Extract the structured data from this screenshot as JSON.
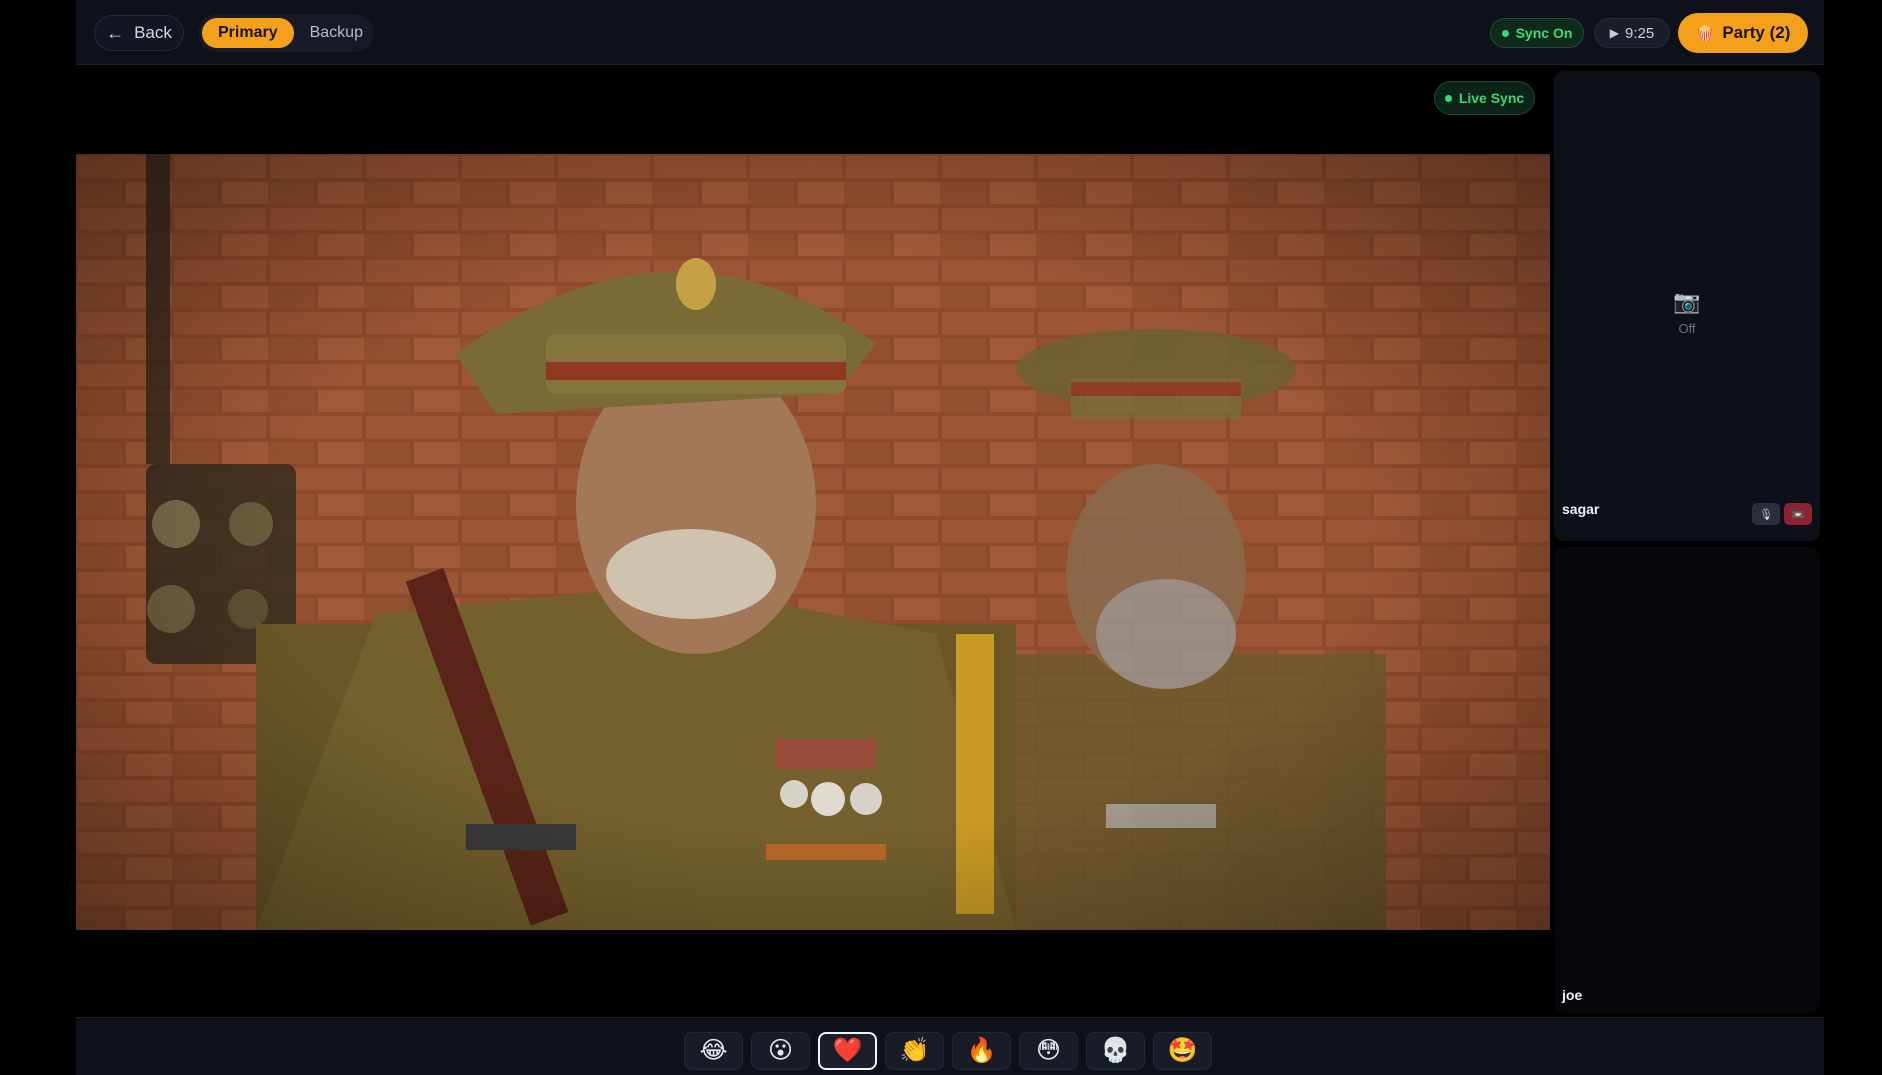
{
  "header": {
    "back_label": "Back",
    "sources": [
      {
        "label": "Primary",
        "active": true
      },
      {
        "label": "Backup",
        "active": false
      }
    ],
    "sync_label": "Sync On",
    "time_label": "9:25",
    "party_label": "Party (2)"
  },
  "player": {
    "live_label": "Live Sync"
  },
  "participants": [
    {
      "name": "sagar",
      "camera_status": "Off",
      "mic_icon": "mic-icon",
      "camera_icon": "camera-off-icon"
    },
    {
      "name": "joe"
    }
  ],
  "reactions": [
    {
      "emoji": "😂",
      "name": "laugh"
    },
    {
      "emoji": "😮",
      "name": "wow"
    },
    {
      "emoji": "❤️",
      "name": "heart",
      "selected": true
    },
    {
      "emoji": "👏",
      "name": "clap"
    },
    {
      "emoji": "🔥",
      "name": "fire"
    },
    {
      "emoji": "😳",
      "name": "flushed"
    },
    {
      "emoji": "💀",
      "name": "skull"
    },
    {
      "emoji": "🤩",
      "name": "star-struck"
    }
  ],
  "colors": {
    "accent": "#f5a01a",
    "sync_green": "#3ddc7a",
    "panel_bg": "#0e1119"
  }
}
